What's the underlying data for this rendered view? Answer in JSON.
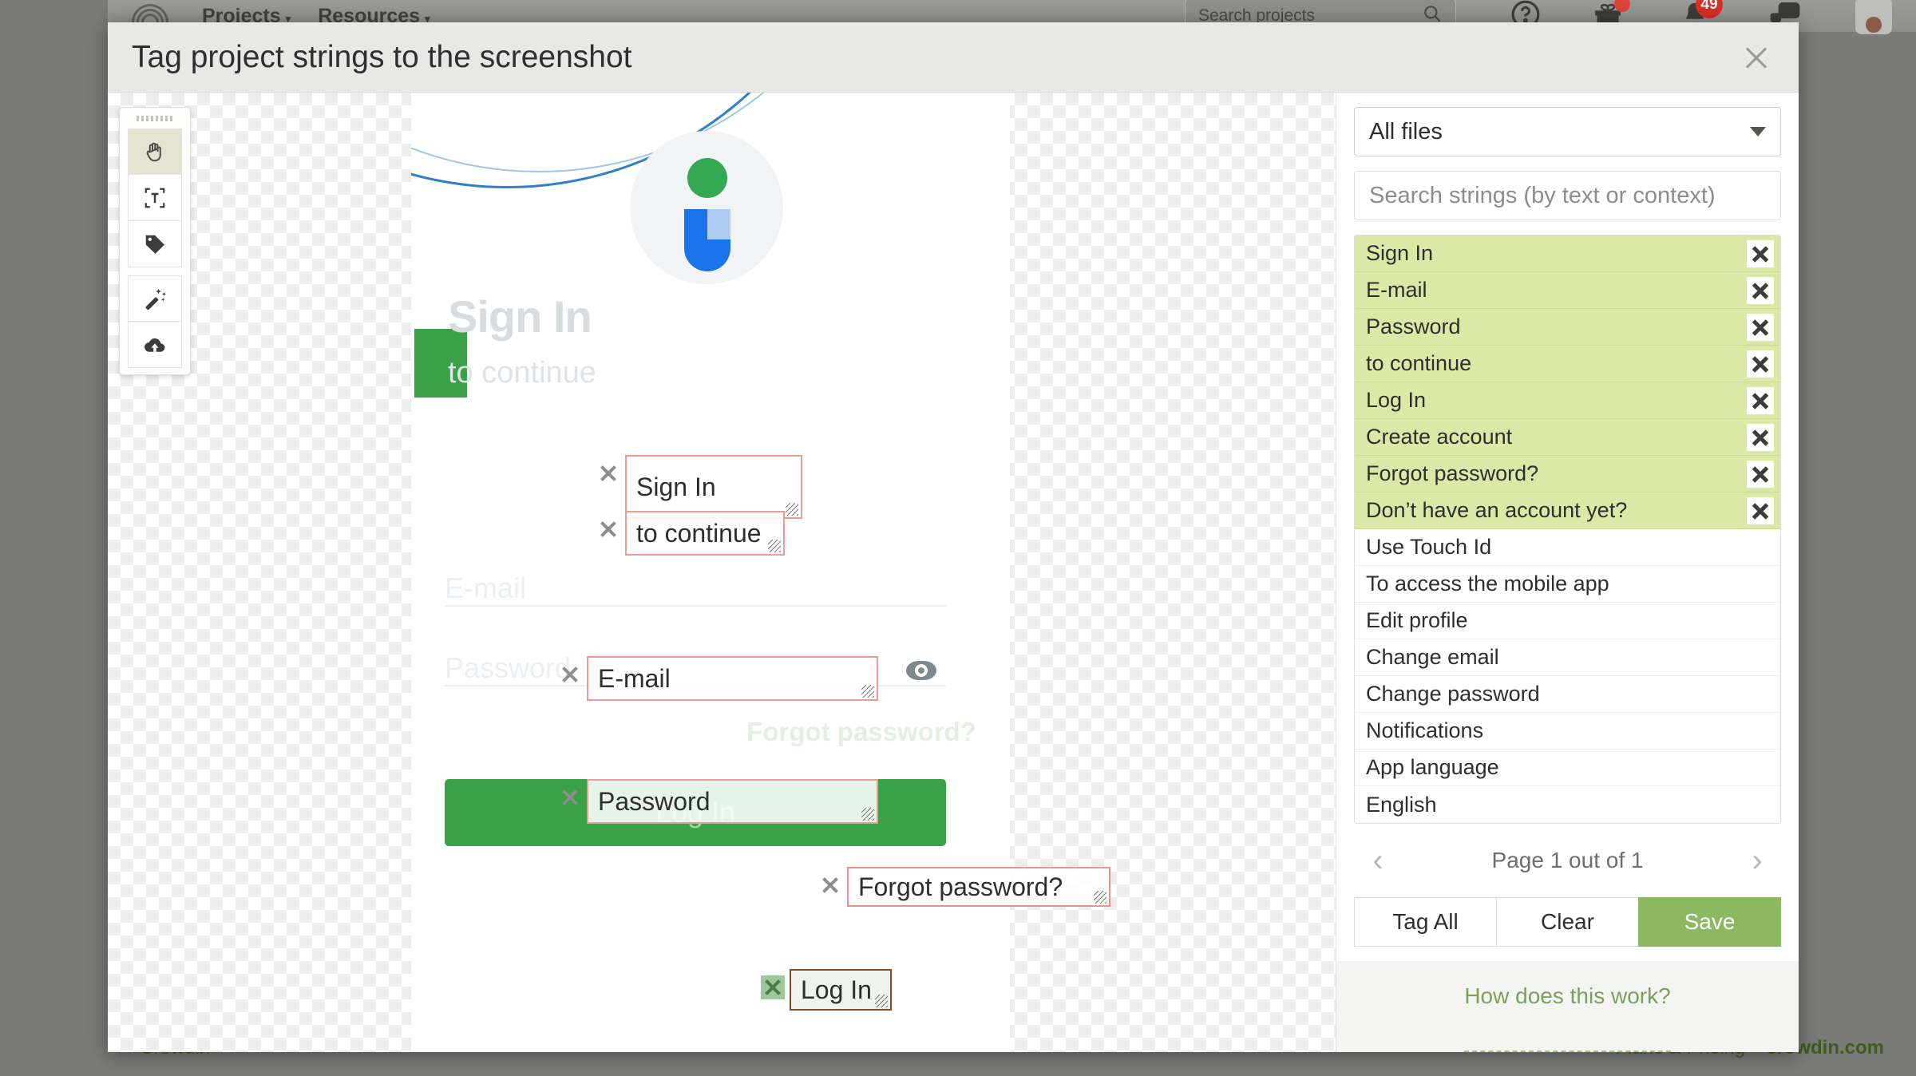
{
  "background": {
    "nav": {
      "logo_icon": "crowdin-logo-icon",
      "menus": [
        {
          "label": "Projects",
          "caret": "▾"
        },
        {
          "label": "Resources",
          "caret": "▾"
        }
      ],
      "search_placeholder": "Search projects",
      "search_icon": "search-icon",
      "help_icon": "help-circle-icon",
      "gift_icon": "gift-icon",
      "bell_icon": "bell-icon",
      "bell_badge": "49",
      "messages_icon": "messages-icon",
      "avatar": "user-avatar"
    },
    "footer": {
      "left": "Crowdin",
      "plans": "Plans & Pricing",
      "domain": "crowdin.com"
    }
  },
  "modal": {
    "title": "Tag project strings to the screenshot",
    "close_icon": "close-icon"
  },
  "toolbar": {
    "grip": "drag-handle",
    "tools": [
      {
        "name": "hand-tool-icon",
        "label": "Pan",
        "active": true
      },
      {
        "name": "text-select-tool-icon",
        "label": "Select text",
        "active": false
      },
      {
        "name": "tag-tool-icon",
        "label": "Tag",
        "active": false
      },
      {
        "name": "magic-wand-tool-icon",
        "label": "Auto tag",
        "active": false
      },
      {
        "name": "cloud-upload-icon",
        "label": "Upload",
        "active": false
      }
    ]
  },
  "canvas": {
    "mock": {
      "heading": "Sign In",
      "subheading": "to continue",
      "email_placeholder": "E-mail",
      "password_placeholder": "Password",
      "forgot": "Forgot password?",
      "login_button": "Log In",
      "eye_icon": "eye-icon",
      "logo_icon": "app-logo-icon"
    },
    "tags": [
      {
        "id": "tag-signin",
        "text": "Sign In",
        "remove_icon": "remove-tag-icon",
        "resize_icon": "resize-grip-icon"
      },
      {
        "id": "tag-continue",
        "text": "to continue",
        "remove_icon": "remove-tag-icon",
        "resize_icon": "resize-grip-icon"
      },
      {
        "id": "tag-email",
        "text": "E-mail",
        "remove_icon": "remove-tag-icon",
        "resize_icon": "resize-grip-icon"
      },
      {
        "id": "tag-password",
        "text": "Password",
        "remove_icon": "remove-tag-icon",
        "resize_icon": "resize-grip-icon"
      },
      {
        "id": "tag-forgot",
        "text": "Forgot password?",
        "remove_icon": "remove-tag-icon",
        "resize_icon": "resize-grip-icon"
      },
      {
        "id": "tag-login",
        "text": "Log In",
        "remove_icon": "remove-tag-icon",
        "resize_icon": "resize-grip-icon"
      }
    ]
  },
  "panel": {
    "file_filter": {
      "value": "All files",
      "caret_icon": "chevron-down-icon"
    },
    "search": {
      "placeholder": "Search strings (by text or context)",
      "value": ""
    },
    "strings": [
      {
        "text": "Sign In",
        "tagged": true
      },
      {
        "text": "E-mail",
        "tagged": true
      },
      {
        "text": "Password",
        "tagged": true
      },
      {
        "text": "to continue",
        "tagged": true
      },
      {
        "text": "Log In",
        "tagged": true
      },
      {
        "text": "Create account",
        "tagged": true
      },
      {
        "text": "Forgot password?",
        "tagged": true
      },
      {
        "text": "Don’t have an account yet?",
        "tagged": true
      },
      {
        "text": "Use Touch Id",
        "tagged": false
      },
      {
        "text": "To access the mobile app",
        "tagged": false
      },
      {
        "text": "Edit profile",
        "tagged": false
      },
      {
        "text": "Change email",
        "tagged": false
      },
      {
        "text": "Change password",
        "tagged": false
      },
      {
        "text": "Notifications",
        "tagged": false
      },
      {
        "text": "App language",
        "tagged": false
      },
      {
        "text": "English",
        "tagged": false
      }
    ],
    "pager": {
      "prev_icon": "chevron-left-icon",
      "label": "Page 1 out of 1",
      "next_icon": "chevron-right-icon"
    },
    "actions": {
      "tag_all": "Tag All",
      "clear": "Clear",
      "save": "Save"
    },
    "help_link": "How does this work?"
  },
  "colors": {
    "accent_green": "#8cb862",
    "tagged_row": "#dbe8a6",
    "tag_border": "#eb9c95",
    "mock_button": "#3aa148"
  }
}
